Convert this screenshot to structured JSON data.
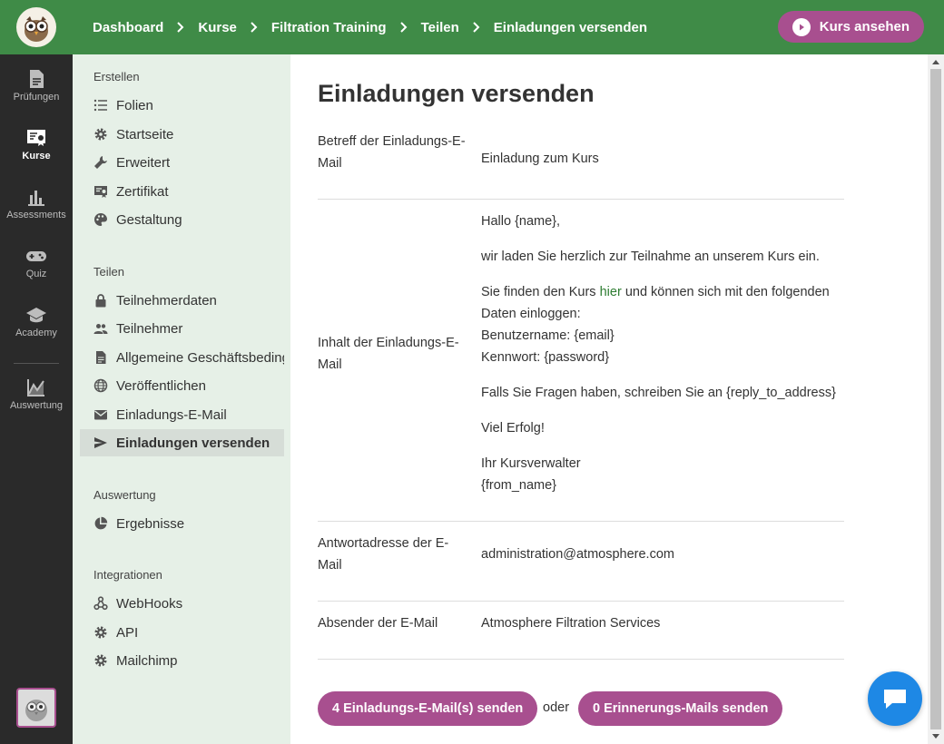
{
  "breadcrumb": [
    "Dashboard",
    "Kurse",
    "Filtration Training",
    "Teilen",
    "Einladungen versenden"
  ],
  "view_button": "Kurs ansehen",
  "rail": [
    {
      "label": "Prüfungen",
      "icon": "document-icon"
    },
    {
      "label": "Kurse",
      "icon": "certificate-icon",
      "active": true
    },
    {
      "label": "Assessments",
      "icon": "bar-chart-icon"
    },
    {
      "label": "Quiz",
      "icon": "gamepad-icon"
    },
    {
      "label": "Academy",
      "icon": "graduation-cap-icon"
    },
    {
      "label": "Auswertung",
      "icon": "line-chart-icon"
    }
  ],
  "sidebar": {
    "sections": [
      "Erstellen",
      "Teilen",
      "Auswertung",
      "Integrationen"
    ],
    "items": [
      {
        "label": "Folien",
        "icon": "list-icon"
      },
      {
        "label": "Startseite",
        "icon": "gear-icon"
      },
      {
        "label": "Erweitert",
        "icon": "wrench-icon"
      },
      {
        "label": "Zertifikat",
        "icon": "certificate-icon"
      },
      {
        "label": "Gestaltung",
        "icon": "palette-icon"
      },
      {
        "label": "Teilnehmerdaten",
        "icon": "lock-icon"
      },
      {
        "label": "Teilnehmer",
        "icon": "people-icon"
      },
      {
        "label": "Allgemeine Geschäftsbedingungen",
        "icon": "file-icon"
      },
      {
        "label": "Veröffentlichen",
        "icon": "globe-icon"
      },
      {
        "label": "Einladungs-E-Mail",
        "icon": "mail-icon"
      },
      {
        "label": "Einladungen versenden",
        "icon": "send-icon",
        "active": true
      },
      {
        "label": "Ergebnisse",
        "icon": "pie-chart-icon"
      },
      {
        "label": "WebHooks",
        "icon": "webhook-icon"
      },
      {
        "label": "API",
        "icon": "gear-icon"
      },
      {
        "label": "Mailchimp",
        "icon": "gear-icon"
      }
    ]
  },
  "main": {
    "title": "Einladungen versenden",
    "rows": [
      {
        "label": "Betreff der Einladungs-E-Mail",
        "value": "Einladung zum Kurs"
      },
      {
        "label": "Inhalt der Einladungs-E-Mail"
      },
      {
        "label": "Antwortadresse der E-Mail",
        "value": "administration@atmosphere.com"
      },
      {
        "label": "Absender der E-Mail",
        "value": "Atmosphere Filtration Services"
      }
    ],
    "body": {
      "greeting": "Hallo {name},",
      "invite": "wir laden Sie herzlich zur Teilnahme an unserem Kurs ein.",
      "find_pre": "Sie finden den Kurs",
      "find_link": "hier",
      "find_post": "und können sich mit den folgenden Daten einloggen:",
      "username": "Benutzername: {email}",
      "password": "Kennwort: {password}",
      "questions": "Falls Sie Fragen haben, schreiben Sie an {reply_to_address}",
      "luck": "Viel Erfolg!",
      "sign": "Ihr Kursverwalter",
      "from": "{from_name}"
    },
    "send_button": "4 Einladungs-E-Mail(s) senden",
    "or": "oder",
    "reminder_button": "0 Erinnerungs-Mails senden"
  },
  "colors": {
    "topbar": "#3f8b47",
    "accent": "#a84f8f",
    "rail": "#2a2a2a",
    "sidebar": "#e6f0e7",
    "chat": "#1e88e5"
  }
}
